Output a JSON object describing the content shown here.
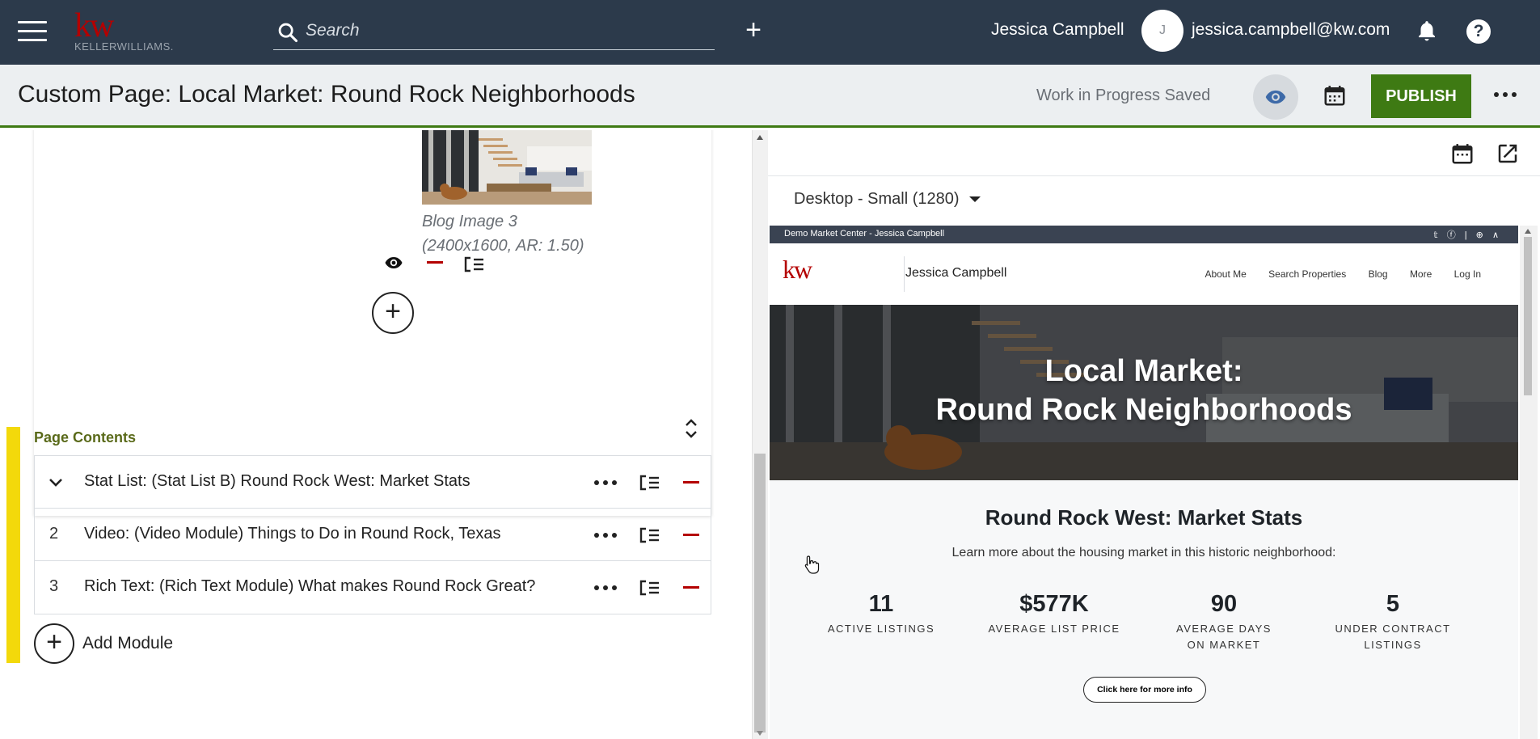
{
  "topbar": {
    "logo_mark": "kw",
    "logo_text": "KELLERWILLIAMS.",
    "search_placeholder": "Search",
    "user_name": "Jessica Campbell",
    "avatar_initial": "J",
    "user_email": "jessica.campbell@kw.com"
  },
  "subheader": {
    "page_title": "Custom Page: Local Market: Round Rock Neighborhoods",
    "save_status": "Work in Progress Saved",
    "publish_label": "PUBLISH"
  },
  "image_card": {
    "caption_line1": "Blog Image 3",
    "caption_line2": "(2400x1600, AR: 1.50)"
  },
  "page_contents": {
    "label": "Page Contents",
    "modules": [
      {
        "index": "",
        "title": "Stat List: (Stat List B) Round Rock West: Market Stats",
        "expanded": true
      },
      {
        "index": "2",
        "title": "Video: (Video Module) Things to Do in Round Rock, Texas"
      },
      {
        "index": "3",
        "title": "Rich Text: (Rich Text Module) What makes Round Rock Great?"
      }
    ],
    "add_module_label": "Add Module"
  },
  "preview": {
    "device": "Desktop - Small (1280)",
    "strip_text": "Demo Market Center - Jessica Campbell",
    "logo": "kw",
    "agent_name": "Jessica Campbell",
    "nav_links": [
      "About Me",
      "Search Properties",
      "Blog",
      "More",
      "Log In"
    ],
    "hero_line1": "Local Market:",
    "hero_line2": "Round Rock Neighborhoods",
    "stats_title": "Round Rock West: Market Stats",
    "stats_subtitle": "Learn more about the housing market in this historic neighborhood:",
    "stats": [
      {
        "value": "11",
        "label_1": "ACTIVE LISTINGS",
        "label_2": ""
      },
      {
        "value": "$577K",
        "label_1": "AVERAGE LIST PRICE",
        "label_2": ""
      },
      {
        "value": "90",
        "label_1": "AVERAGE DAYS",
        "label_2": "ON MARKET"
      },
      {
        "value": "5",
        "label_1": "UNDER CONTRACT",
        "label_2": "LISTINGS"
      }
    ],
    "cta_label": "Click here for more info"
  },
  "colors": {
    "topbar": "#2c3a4b",
    "brand_red": "#b40101",
    "publish_green": "#3e7a13",
    "highlight_yellow": "#f3d90b"
  }
}
